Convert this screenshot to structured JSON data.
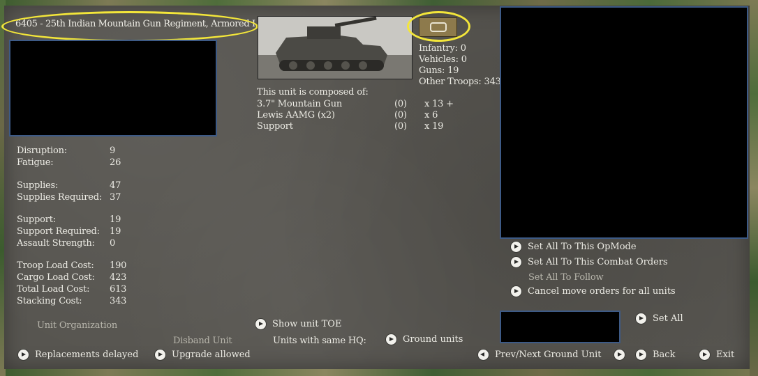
{
  "unit": {
    "title": "6405 - 25th Indian Mountain Gun Regiment, Armored I"
  },
  "counts": {
    "infantry": "Infantry: 0",
    "vehicles": "Vehicles: 0",
    "guns": "Guns: 19",
    "other_troops": "Other Troops: 343"
  },
  "composition": {
    "header": "This unit is composed of:",
    "rows": [
      {
        "name": "3.7\" Mountain Gun",
        "damaged": "(0)",
        "count": "x 13 +"
      },
      {
        "name": "Lewis AAMG (x2)",
        "damaged": "(0)",
        "count": "x 6"
      },
      {
        "name": "Support",
        "damaged": "(0)",
        "count": "x 19"
      }
    ]
  },
  "stats": {
    "disruption": {
      "label": "Disruption:",
      "value": "9"
    },
    "fatigue": {
      "label": "Fatigue:",
      "value": "26"
    },
    "supplies": {
      "label": "Supplies:",
      "value": "47"
    },
    "supplies_required": {
      "label": "Supplies Required:",
      "value": "37"
    },
    "support": {
      "label": "Support:",
      "value": "19"
    },
    "support_required": {
      "label": "Support Required:",
      "value": "19"
    },
    "assault_strength": {
      "label": "Assault Strength:",
      "value": "0"
    },
    "troop_load_cost": {
      "label": "Troop Load Cost:",
      "value": "190"
    },
    "cargo_load_cost": {
      "label": "Cargo Load Cost:",
      "value": "423"
    },
    "total_load_cost": {
      "label": "Total Load Cost:",
      "value": "613"
    },
    "stacking_cost": {
      "label": "Stacking Cost:",
      "value": "343"
    }
  },
  "actions": {
    "set_all_opmode": "Set All To This OpMode",
    "set_all_combat_orders": "Set All To This Combat Orders",
    "set_all_follow": "Set All To Follow",
    "cancel_move_orders": "Cancel move orders for all units",
    "set_all": "Set All",
    "show_unit_toe": "Show unit TOE",
    "unit_organization": "Unit Organization",
    "disband_unit": "Disband Unit",
    "units_same_hq": "Units with same HQ:",
    "ground_units": "Ground units",
    "replacements_delayed": "Replacements delayed",
    "upgrade_allowed": "Upgrade allowed",
    "prev_next": "Prev/Next Ground Unit",
    "back": "Back",
    "exit": "Exit"
  },
  "icons": {
    "unit_type": "unit-type-icon",
    "arrow": "arrow-right-icon",
    "arrow_left": "arrow-left-icon"
  },
  "colors": {
    "highlight": "#f3e63a",
    "panel": "#575550",
    "box_border": "#3d5a86"
  }
}
